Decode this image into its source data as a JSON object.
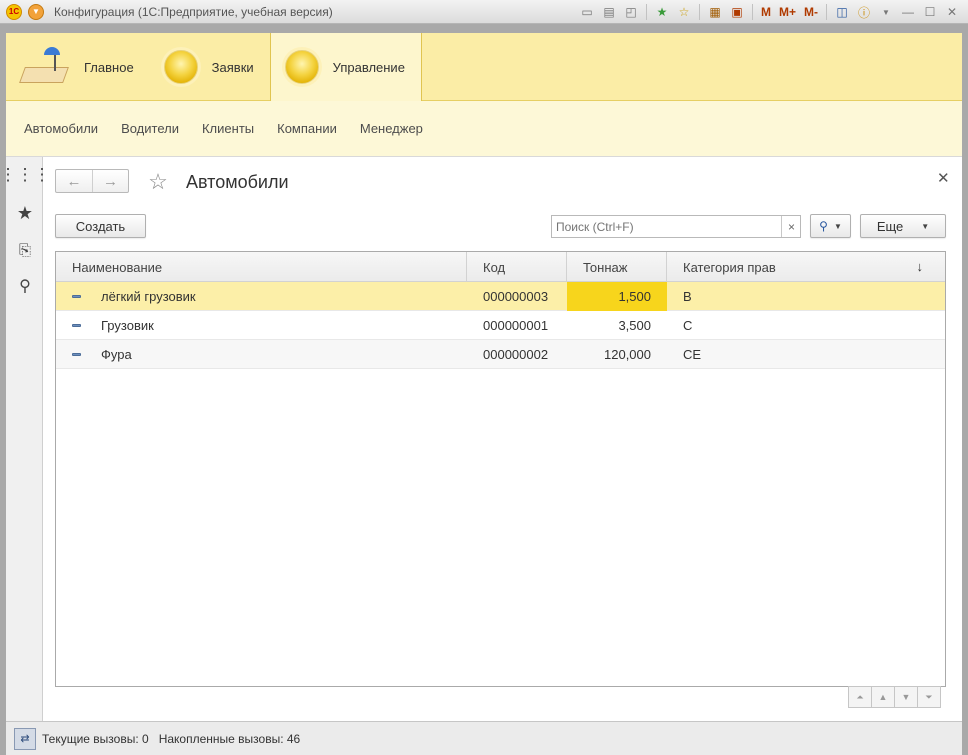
{
  "window": {
    "title": "Конфигурация  (1С:Предприятие, учебная версия)",
    "logo_text": "1С"
  },
  "toolbar": {
    "icons": [
      "save-icon",
      "print-icon",
      "preview-icon",
      "add-favorite-icon",
      "favorites-icon",
      "calculator-icon",
      "calendar-icon"
    ],
    "memory_buttons": [
      "M",
      "M+",
      "M-"
    ]
  },
  "sections": [
    {
      "label": "Главное",
      "icon": "desk-lamp-icon",
      "active": false
    },
    {
      "label": "Заявки",
      "icon": "section-orb-icon",
      "active": false
    },
    {
      "label": "Управление",
      "icon": "section-orb-icon",
      "active": true
    }
  ],
  "function_panel": [
    "Автомобили",
    "Водители",
    "Клиенты",
    "Компании",
    "Менеджер"
  ],
  "left_strip": [
    "menu-grid-icon",
    "favorites-star-icon",
    "history-icon",
    "search-icon"
  ],
  "form": {
    "title": "Автомобили",
    "create_label": "Создать",
    "search_placeholder": "Поиск (Ctrl+F)",
    "more_label": "Еще",
    "columns": [
      "Наименование",
      "Код",
      "Тоннаж",
      "Категория прав"
    ],
    "sort_indicator": "↓",
    "rows": [
      {
        "name": "лёгкий грузовик",
        "code": "000000003",
        "tonnage": "1,500",
        "category": "B"
      },
      {
        "name": "Грузовик",
        "code": "000000001",
        "tonnage": "3,500",
        "category": "C"
      },
      {
        "name": "Фура",
        "code": "000000002",
        "tonnage": "120,000",
        "category": "CE"
      }
    ]
  },
  "status": {
    "current_calls": "Текущие вызовы: 0",
    "accumulated_calls": "Накопленные вызовы: 46"
  }
}
